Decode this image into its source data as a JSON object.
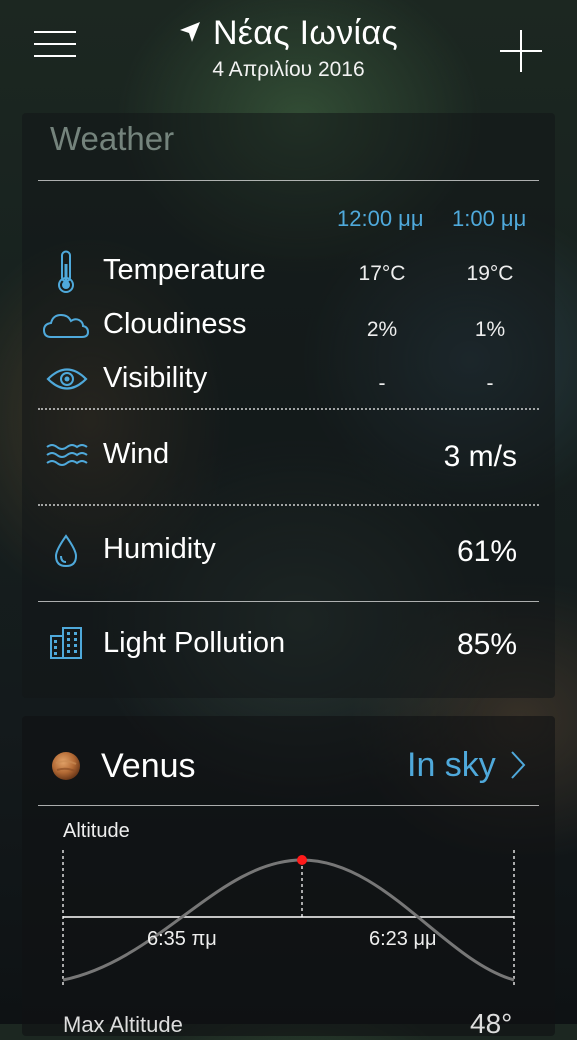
{
  "header": {
    "location": "Νέας Ιωνίας",
    "date": "4 Απριλίου 2016",
    "location_icon": "location-arrow-icon",
    "menu_icon": "hamburger-menu-icon",
    "add_icon": "plus-icon"
  },
  "weather": {
    "title": "Weather",
    "times": [
      "12:00 μμ",
      "1:00 μμ"
    ],
    "rows": [
      {
        "label": "Temperature",
        "icon": "thermometer-icon",
        "values": [
          "17°C",
          "19°C"
        ]
      },
      {
        "label": "Cloudiness",
        "icon": "cloud-icon",
        "values": [
          "2%",
          "1%"
        ]
      },
      {
        "label": "Visibility",
        "icon": "eye-icon",
        "values": [
          "-",
          "-"
        ]
      }
    ],
    "wind": {
      "label": "Wind",
      "icon": "wind-icon",
      "value": "3 m/s"
    },
    "humidity": {
      "label": "Humidity",
      "icon": "water-drop-icon",
      "value": "61%"
    },
    "light_pollution": {
      "label": "Light Pollution",
      "icon": "buildings-icon",
      "value": "85%"
    }
  },
  "venus": {
    "name": "Venus",
    "status": "In sky",
    "altitude_label": "Altitude",
    "rise_time": "6:35 πμ",
    "set_time": "6:23 μμ",
    "max_altitude_label": "Max Altitude",
    "max_altitude_value": "48°"
  },
  "colors": {
    "accent": "#4fa9db",
    "peak_marker": "#ff1a1a"
  }
}
